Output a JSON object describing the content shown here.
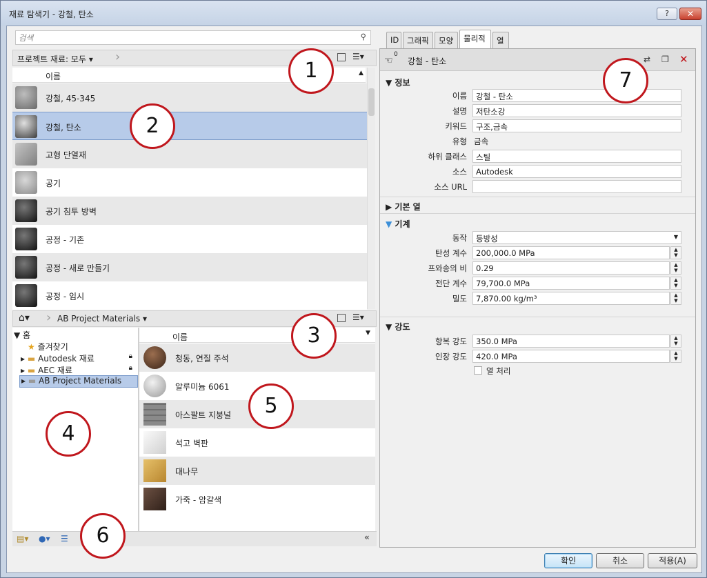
{
  "window": {
    "title": "재료 탐색기 - 강철, 탄소",
    "help": "?",
    "close": "✕"
  },
  "search": {
    "placeholder": "검색"
  },
  "project": {
    "breadcrumb": "프로젝트 재료: 모두",
    "column": "이름",
    "items": [
      {
        "label": "강철, 45-345",
        "color": "#7d7d7d"
      },
      {
        "label": "강철, 탄소",
        "color": "#5a5a5a"
      },
      {
        "label": "고형 단열재",
        "color": "#9a9a9a"
      },
      {
        "label": "공기",
        "color": "#a9a9a9"
      },
      {
        "label": "공기 침투 방벽",
        "color": "#2e2e2e"
      },
      {
        "label": "공정 - 기존",
        "color": "#2e2e2e"
      },
      {
        "label": "공정 - 새로 만들기",
        "color": "#2e2e2e"
      },
      {
        "label": "공정 - 임시",
        "color": "#2e2e2e"
      }
    ]
  },
  "library": {
    "breadcrumb": "AB Project Materials",
    "column": "이름",
    "tree": [
      {
        "label": "홈"
      },
      {
        "label": "즐겨찾기"
      },
      {
        "label": "Autodesk 재료"
      },
      {
        "label": "AEC 재료"
      },
      {
        "label": "AB Project Materials"
      }
    ],
    "items": [
      {
        "label": "청동, 연질 주석",
        "color": "#5b3b2a"
      },
      {
        "label": "알루미늄 6061",
        "color": "#c9c9c9"
      },
      {
        "label": "아스팔트 지붕널",
        "color": "#8a8a8a"
      },
      {
        "label": "석고 벽판",
        "color": "#e8e8e8"
      },
      {
        "label": "대나무",
        "color": "#d4a94a"
      },
      {
        "label": "가죽 - 암갈색",
        "color": "#4d382e"
      }
    ]
  },
  "tabs": [
    "ID",
    "그래픽",
    "모양",
    "물리적",
    "열"
  ],
  "asset": {
    "count": "0",
    "name": "강철 - 탄소"
  },
  "info": {
    "header": "정보",
    "fields": {
      "name_label": "이름",
      "name": "강철 - 탄소",
      "desc_label": "설명",
      "desc": "저탄소강",
      "kw_label": "키워드",
      "kw": "구조,금속",
      "type_label": "유형",
      "type": "금속",
      "sub_label": "하위 클래스",
      "sub": "스틸",
      "src_label": "소스",
      "src": "Autodesk",
      "url_label": "소스 URL",
      "url": ""
    }
  },
  "basic_thermal": {
    "header": "기본 열"
  },
  "mechanical": {
    "header": "기계",
    "fields": {
      "behavior_label": "동작",
      "behavior": "등방성",
      "young_label": "탄성 계수",
      "young": "200,000.0 MPa",
      "poisson_label": "프와송의 비",
      "poisson": "0.29",
      "shear_label": "전단 계수",
      "shear": "79,700.0 MPa",
      "density_label": "밀도",
      "density": "7,870.00 kg/m³"
    }
  },
  "strength": {
    "header": "강도",
    "fields": {
      "yield_label": "항복 강도",
      "yield": "350.0 MPa",
      "tensile_label": "인장 강도",
      "tensile": "420.0 MPa",
      "heat_label": "열 처리"
    }
  },
  "buttons": {
    "ok": "확인",
    "cancel": "취소",
    "apply": "적용(A)"
  },
  "callouts": [
    "1",
    "2",
    "3",
    "4",
    "5",
    "6",
    "7"
  ],
  "colors": {
    "selection": "#b7cbe9",
    "callout": "#c0171d"
  }
}
